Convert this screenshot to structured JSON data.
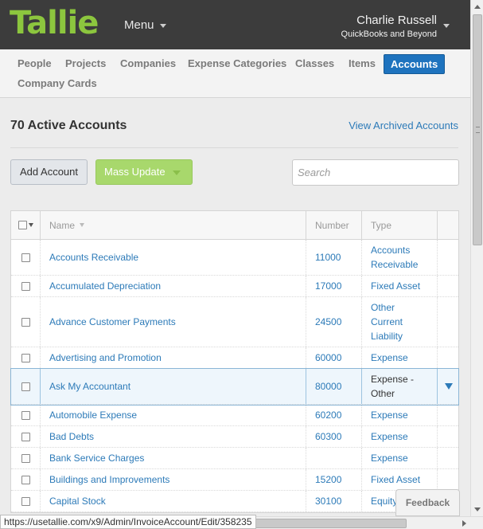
{
  "app": {
    "logo_text": "Tallie",
    "menu_label": "Menu",
    "user_name": "Charlie Russell",
    "user_company": "QuickBooks and Beyond"
  },
  "nav": {
    "people": "People",
    "projects": "Projects",
    "companies": "Companies",
    "expense_categories": "Expense Categories",
    "classes": "Classes",
    "items": "Items",
    "accounts": "Accounts",
    "company_cards": "Company Cards",
    "active": "Accounts"
  },
  "page": {
    "title": "70 Active Accounts",
    "archived_link": "View Archived Accounts"
  },
  "toolbar": {
    "add_label": "Add Account",
    "mass_update_label": "Mass Update",
    "search_placeholder": "Search"
  },
  "table": {
    "headers": {
      "name": "Name",
      "number": "Number",
      "type": "Type"
    },
    "rows": [
      {
        "name": "Accounts Receivable",
        "number": "11000",
        "type": "Accounts Receivable"
      },
      {
        "name": "Accumulated Depreciation",
        "number": "17000",
        "type": "Fixed Asset"
      },
      {
        "name": "Advance Customer Payments",
        "number": "24500",
        "type": "Other Current Liability"
      },
      {
        "name": "Advertising and Promotion",
        "number": "60000",
        "type": "Expense"
      },
      {
        "name": "Ask My Accountant",
        "number": "80000",
        "type": "Expense - Other",
        "highlighted": true
      },
      {
        "name": "Automobile Expense",
        "number": "60200",
        "type": "Expense"
      },
      {
        "name": "Bad Debts",
        "number": "60300",
        "type": "Expense"
      },
      {
        "name": "Bank Service Charges",
        "number": "",
        "type": "Expense"
      },
      {
        "name": "Buildings and Improvements",
        "number": "15200",
        "type": "Fixed Asset"
      },
      {
        "name": "Capital Stock",
        "number": "30100",
        "type": "Equity"
      }
    ]
  },
  "feedback_label": "Feedback",
  "status_url": "https://usetallie.com/x9/Admin/InvoiceAccount/Edit/358235",
  "colors": {
    "accent": "#1e73be",
    "brand": "#8cc63e",
    "mass_update": "#a8d86c"
  }
}
